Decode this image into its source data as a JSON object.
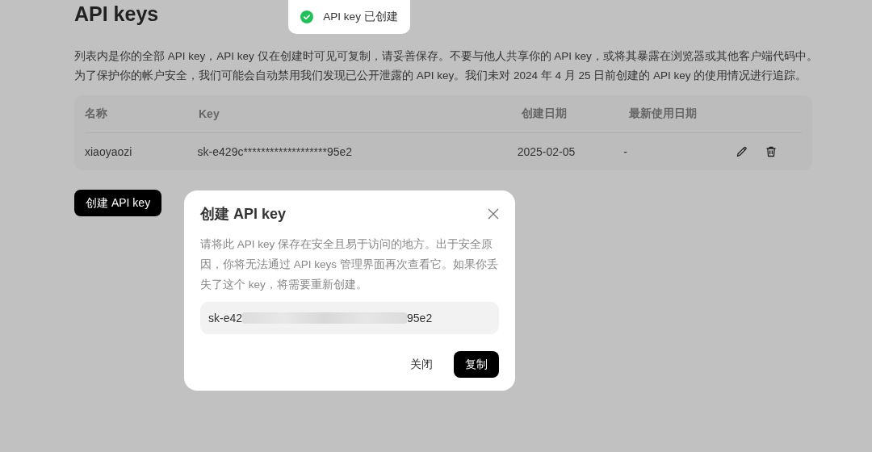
{
  "page": {
    "title": "API keys",
    "description": [
      "列表内是你的全部 API key，API key 仅在创建时可见可复制，请妥善保存。不要与他人共享你的 API key，或将其暴露在浏览器或其他客户端代码中。",
      "为了保护你的帐户安全，我们可能会自动禁用我们发现已公开泄露的 API key。我们未对 2024 年 4 月 25 日前创建的 API key 的使用情况进行追踪。"
    ]
  },
  "toast": {
    "kind": "success",
    "text": "API key 已创建"
  },
  "table": {
    "columns": [
      "名称",
      "Key",
      "创建日期",
      "最新使用日期"
    ],
    "rows": [
      {
        "name": "xiaoyaozi",
        "key": "sk-e429c*******************95e2",
        "created": "2025-02-05",
        "last_used": "-"
      }
    ]
  },
  "create_button": "创建 API key",
  "dialog": {
    "title": "创建 API key",
    "body": "请将此 API key 保存在安全且易于访问的地方。出于安全原因，你将无法通过 API keys 管理界面再次查看它。如果你丢失了这个 key，将需要重新创建。",
    "key_start": "sk-e42",
    "key_end": "95e2",
    "redacted": true,
    "buttons": [
      {
        "label": "关闭",
        "kind": "text"
      },
      {
        "label": "复制",
        "kind": "primary"
      }
    ]
  }
}
